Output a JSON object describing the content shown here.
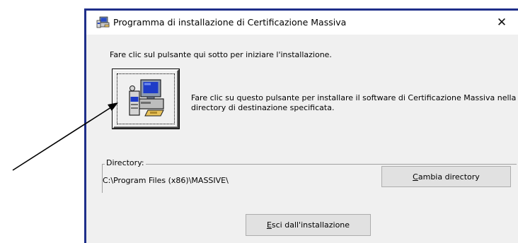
{
  "window": {
    "title": "Programma di installazione di Certificazione Massiva",
    "close_glyph": "✕",
    "instruction": "Fare clic sul pulsante qui sotto per iniziare l'installazione.",
    "install_button": {
      "icon": "computer-setup-icon",
      "description": "Fare clic su questo pulsante per installare il software di Certificazione Massiva nella directory di destinazione specificata."
    },
    "directory_group": {
      "label": "Directory:",
      "path": "C:\\Program Files (x86)\\MASSIVE\\",
      "change_button": {
        "mnemonic": "C",
        "rest": "ambia directory"
      }
    },
    "exit_button": {
      "mnemonic": "E",
      "rest": "sci dall'installazione"
    }
  },
  "colors": {
    "frame": "#1f2f8a",
    "dialog_bg": "#f0f0f0",
    "button_bg": "#e1e1e1"
  }
}
